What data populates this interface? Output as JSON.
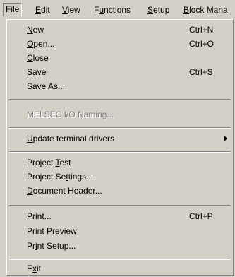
{
  "menubar": {
    "items": [
      {
        "label": "File",
        "accel": "F"
      },
      {
        "label": "Edit",
        "accel": "E"
      },
      {
        "label": "View",
        "accel": "V"
      },
      {
        "label": "Functions",
        "accel": "u"
      },
      {
        "label": "Setup",
        "accel": "S"
      },
      {
        "label": "Block Mana",
        "accel": "B"
      }
    ]
  },
  "file_menu": {
    "items": [
      {
        "label": "New",
        "accel_index": 0,
        "shortcut": "Ctrl+N"
      },
      {
        "label": "Open...",
        "accel_index": 0,
        "shortcut": "Ctrl+O"
      },
      {
        "label": "Close",
        "accel_index": 0
      },
      {
        "label": "Save",
        "accel_index": 0,
        "shortcut": "Ctrl+S"
      },
      {
        "label": "Save As...",
        "accel_index": 5
      },
      {
        "label": "MELSEC I/O Naming...",
        "disabled": true
      },
      {
        "label": "Update terminal drivers",
        "accel_index": 0,
        "submenu": true
      },
      {
        "label": "Project Test",
        "accel_index": 8
      },
      {
        "label": "Project Settings...",
        "accel_index": 10
      },
      {
        "label": "Document Header...",
        "accel_index": 0
      },
      {
        "label": "Print...",
        "accel_index": 0,
        "shortcut": "Ctrl+P"
      },
      {
        "label": "Print Preview",
        "accel_index": 8
      },
      {
        "label": "Print Setup...",
        "accel_index": 2
      },
      {
        "label": "Exit",
        "accel_index": 1
      }
    ]
  }
}
